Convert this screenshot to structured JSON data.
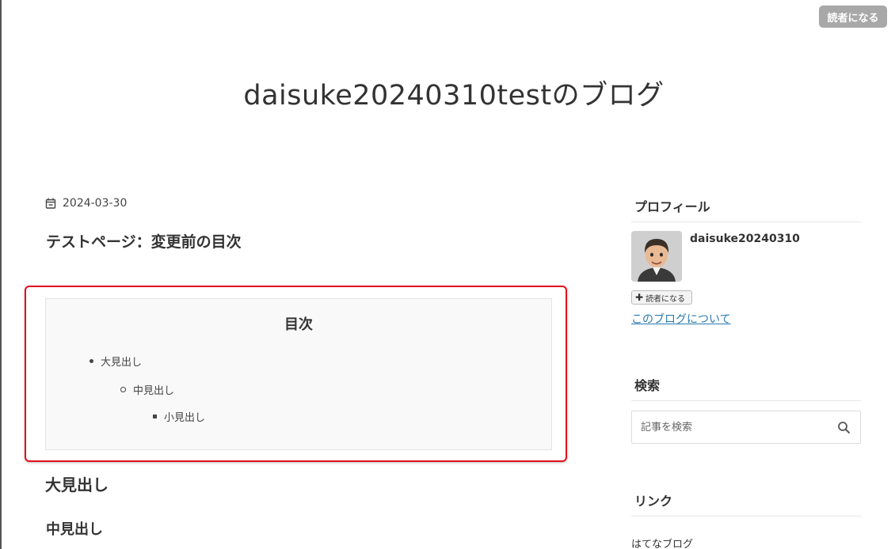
{
  "header": {
    "subscribe_label": "読者になる",
    "blog_title": "daisuke20240310testのブログ"
  },
  "entry": {
    "date": "2024-03-30",
    "title": "テストページ：変更前の目次",
    "toc": {
      "title": "目次",
      "items": [
        {
          "label": "大見出し",
          "level": 1
        },
        {
          "label": "中見出し",
          "level": 2
        },
        {
          "label": "小見出し",
          "level": 3
        }
      ]
    },
    "headings": {
      "large": "大見出し",
      "medium": "中見出し"
    }
  },
  "sidebar": {
    "profile": {
      "heading": "プロフィール",
      "name": "daisuke20240310",
      "subscribe_label": "読者になる",
      "about_link": "このブログについて"
    },
    "search": {
      "heading": "検索",
      "placeholder": "記事を検索"
    },
    "links": {
      "heading": "リンク",
      "items": [
        "はてなブログ"
      ]
    }
  },
  "colors": {
    "highlight_outline": "#e0101a",
    "link": "#2a7ab0",
    "subscribe_bg": "#a8a8a8"
  }
}
